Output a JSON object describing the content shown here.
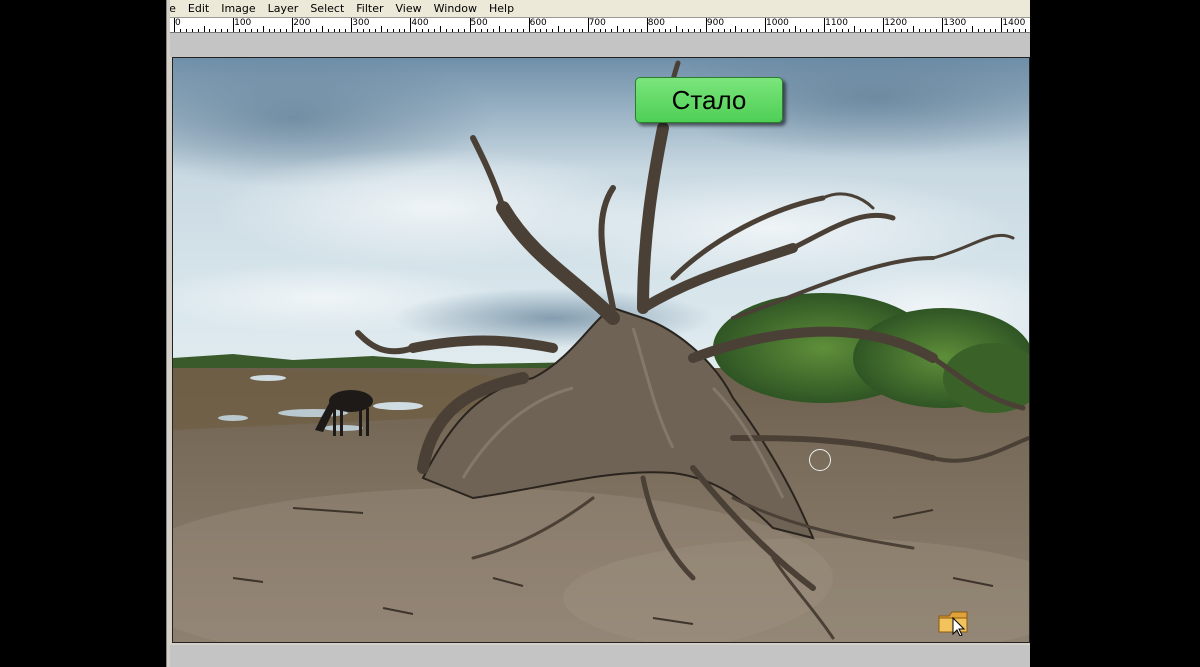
{
  "menu": {
    "items": [
      "ile",
      "Edit",
      "Image",
      "Layer",
      "Select",
      "Filter",
      "View",
      "Window",
      "Help"
    ]
  },
  "ruler": {
    "labels": [
      "0",
      "100",
      "200",
      "300",
      "400",
      "500",
      "600",
      "700",
      "800",
      "900",
      "1000",
      "1100",
      "1200",
      "1300",
      "1400"
    ]
  },
  "canvas": {
    "overlay_label": "Стало",
    "overlay_label_color": "#5fd865"
  },
  "icons": {
    "brush": "brush-cursor-icon",
    "pointer": "folder-pointer-icon"
  }
}
